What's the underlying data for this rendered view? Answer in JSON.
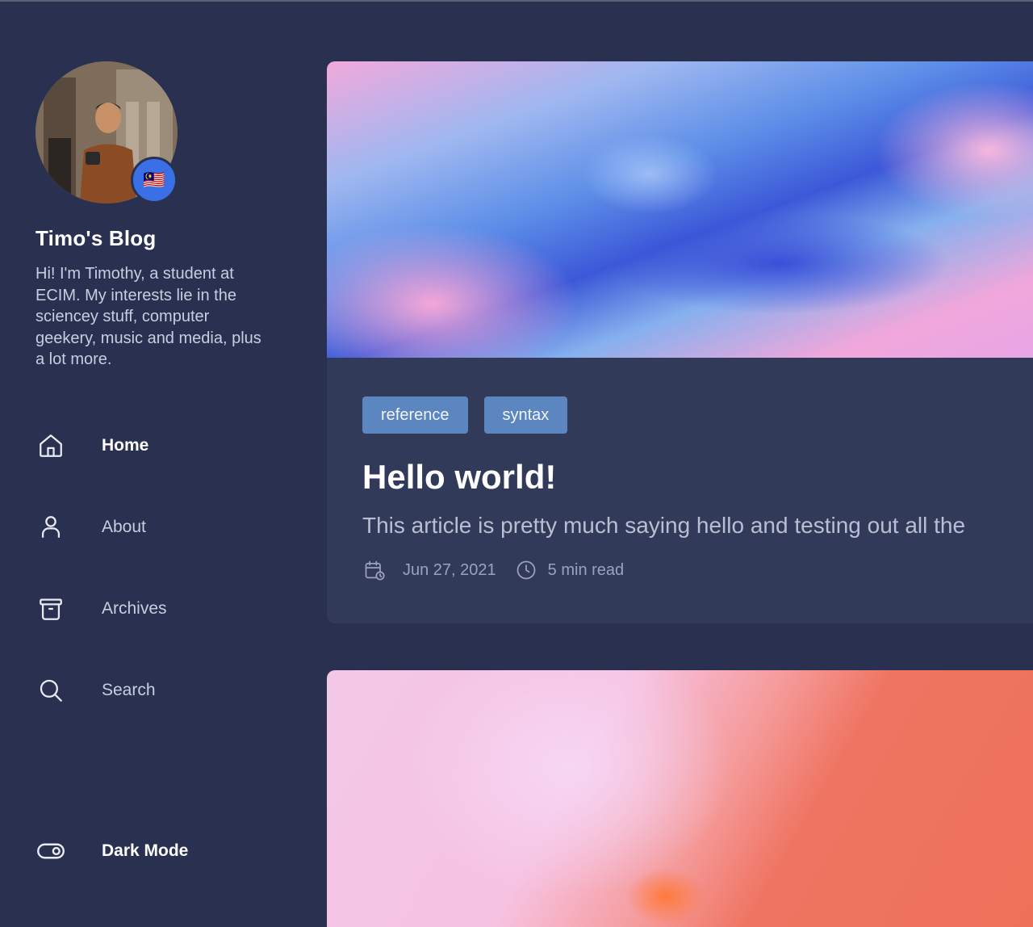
{
  "sidebar": {
    "avatar_flag": "🇲🇾",
    "title": "Timo's Blog",
    "description": "Hi! I'm Timothy, a student at ECIM. My interests lie in the sciencey stuff, computer geekery, music and media, plus a lot more.",
    "nav": [
      {
        "label": "Home",
        "icon": "home-icon",
        "active": true
      },
      {
        "label": "About",
        "icon": "user-icon",
        "active": false
      },
      {
        "label": "Archives",
        "icon": "archive-icon",
        "active": false
      },
      {
        "label": "Search",
        "icon": "search-icon",
        "active": false
      }
    ],
    "dark_mode_label": "Dark Mode"
  },
  "posts": [
    {
      "tags": [
        "reference",
        "syntax"
      ],
      "title": "Hello world!",
      "excerpt": "This article is pretty much saying hello and testing out all the",
      "date": "Jun 27, 2021",
      "read_time": "5 min read"
    }
  ],
  "colors": {
    "background": "#2a3150",
    "card": "#323a5a",
    "tag": "#5b86c0",
    "badge": "#3b6fe6"
  }
}
